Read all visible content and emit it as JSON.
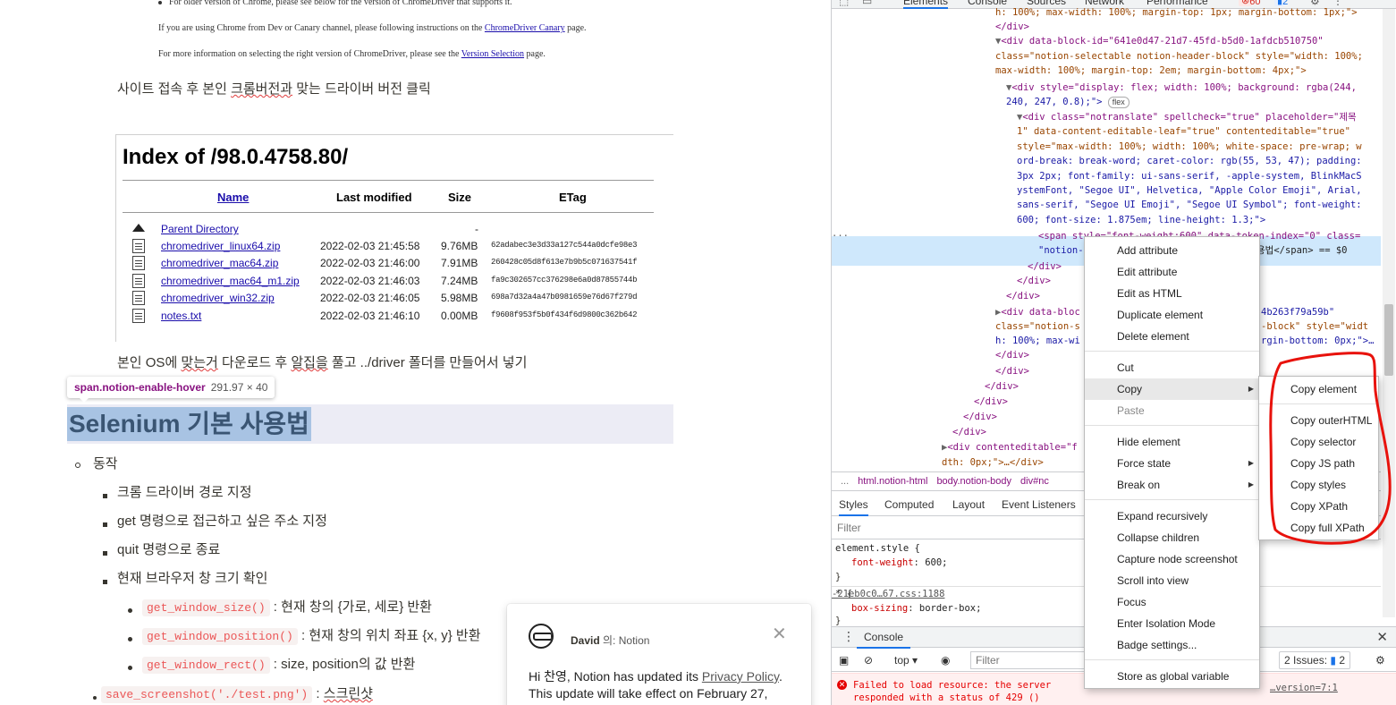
{
  "notion": {
    "top_note1": "For older version of Chrome, please see below for the version of ChromeDriver that supports it.",
    "top_note2_pre": "If you are using Chrome from Dev or Canary channel, please following instructions on the ",
    "top_note2_link": "ChromeDriver Canary",
    "top_note2_post": " page.",
    "top_note3_pre": "For more information on selecting the right version of ChromeDriver, please see the ",
    "top_note3_link": "Version Selection",
    "top_note3_post": " page.",
    "para1_a": "사이트 접속 후 본인 ",
    "para1_b": "크롬버전과",
    "para1_c": " 맞는 드라이버 버전 클릭",
    "index": {
      "title": "Index of /98.0.4758.80/",
      "headers": {
        "name": "Name",
        "modified": "Last modified",
        "size": "Size",
        "etag": "ETag"
      },
      "parent": "Parent Directory",
      "parent_size": "-",
      "rows": [
        {
          "name": "chromedriver_linux64.zip",
          "date": "2022-02-03 21:45:58",
          "size": "9.76MB",
          "etag": "62adabec3e3d33a127c544a0dcfe98e3"
        },
        {
          "name": "chromedriver_mac64.zip",
          "date": "2022-02-03 21:46:00",
          "size": "7.91MB",
          "etag": "260428c05d8f613e7b9b5c071637541f"
        },
        {
          "name": "chromedriver_mac64_m1.zip",
          "date": "2022-02-03 21:46:03",
          "size": "7.24MB",
          "etag": "fa9c302657cc376298e6a0d87855744b"
        },
        {
          "name": "chromedriver_win32.zip",
          "date": "2022-02-03 21:46:05",
          "size": "5.98MB",
          "etag": "698a7d32a4a47b0981659e76d67f279d"
        },
        {
          "name": "notes.txt",
          "date": "2022-02-03 21:46:10",
          "size": "0.00MB",
          "etag": "f9608f953f5b0f434f6d9800c362b642"
        }
      ]
    },
    "para2_a": "본인 OS에 ",
    "para2_b": "맞는거",
    "para2_c": " 다운로드 후 ",
    "para2_d": "알집을",
    "para2_e": " 풀고 ../driver 폴더를 만들어서 넣기",
    "hover_selector": "span.notion-enable-hover",
    "hover_dims": "291.97 × 40",
    "heading": "Selenium 기본 사용법",
    "list": {
      "l1": "동작",
      "l2a": "크롬 드라이버 경로 지정",
      "l2b": "get 명령으로 접근하고 싶은 주소 지정",
      "l2c": "quit 명령으로 종료",
      "l2d": "현재 브라우저 창 크기 확인",
      "c1": "get_window_size()",
      "t1": " : 현재 창의 {가로, 세로} 반환",
      "c2": "get_window_position()",
      "t2": " : 현재 창의 위치 좌표 {x, y} 반환",
      "c3": "get_window_rect()",
      "t3": " : size, position의 값 반환",
      "c4": "save_screenshot('./test.png')",
      "t4a": " : ",
      "t4b": "스크린샷"
    },
    "toast": {
      "author": "David",
      "via": " 의: Notion",
      "close": "✕",
      "msg_pre": "Hi 찬영, Notion has updated its ",
      "msg_link": "Privacy Policy",
      "msg_post": ". This update will take effect on February 27,"
    }
  },
  "devtools": {
    "tabs": [
      "Elements",
      "Console",
      "Sources",
      "Network",
      "Performance"
    ],
    "error_count": "60",
    "info_count": "2",
    "breadcrumbs": [
      "...",
      "html.notion-html",
      "body.notion-body",
      "div#nc"
    ],
    "styles_tabs": [
      "Styles",
      "Computed",
      "Layout",
      "Event Listeners"
    ],
    "filter_placeholder": "Filter",
    "styles": {
      "rule1_sel": "element.style {",
      "rule1_prop": "font-weight",
      "rule1_val": "600;",
      "close": "}",
      "rule2_sel": "* {",
      "rule2_prop": "box-sizing",
      "rule2_val": "border-box;",
      "rule2_src": "-21eb0c0…67.css:1188"
    },
    "console": {
      "tab": "Console",
      "context": "top",
      "filter_placeholder": "Filter",
      "issues_label": "2 Issues:",
      "issues_count": "2",
      "error_line1": "Failed to load resource: the server",
      "error_line2": "responded with a status of 429 ()",
      "error_src": "…version=7:1"
    },
    "elements_lines": [
      "h: 100%; max-width: 100%; margin-top: 1px; margin-bottom: 1px;\">",
      "</div>",
      "<div data-block-id=\"641e0d47-21d7-45fd-b5d0-1afdcb510750\"",
      "class=\"notion-selectable notion-header-block\" style=\"width: 100%;",
      "max-width: 100%; margin-top: 2em; margin-bottom: 4px;\">",
      "<div style=\"display: flex; width: 100%; background: rgba(244,",
      "240, 247, 0.8);\">",
      "<div class=\"notranslate\" spellcheck=\"true\" placeholder=\"제목",
      "1\" data-content-editable-leaf=\"true\" contenteditable=\"true\"",
      "style=\"max-width: 100%; width: 100%; white-space: pre-wrap; w",
      "ord-break: break-word; caret-color: rgb(55, 53, 47); padding:",
      "3px 2px; font-family: ui-sans-serif, -apple-system, BlinkMacS",
      "ystemFont, \"Segoe UI\", Helvetica, \"Apple Color Emoji\", Arial,",
      "sans-serif, \"Segoe UI Emoji\", \"Segoe UI Symbol\"; font-weight:",
      "600; font-size: 1.875em; line-height: 1.3;\">",
      "<span style=\"font-weight:600\" data-token-index=\"0\" class=",
      "\"notion-",
      "용법</span> == $0",
      "</div>",
      "</div>",
      "</div>",
      "<div data-bloc",
      "4b263f79a59b\"",
      "class=\"notion-s",
      "-block\" style=\"widt",
      "h: 100%; max-wi",
      "rgin-bottom: 0px;\">…",
      "</div>",
      "</div>",
      "</div>",
      "</div>",
      "</div>",
      "</div>",
      "<div contenteditable=\"f",
      "dth: 0px;\">…</div>"
    ],
    "flex_pill": "flex"
  },
  "context_menu": {
    "items": [
      "Add attribute",
      "Edit attribute",
      "Edit as HTML",
      "Duplicate element",
      "Delete element",
      "Cut",
      "Copy",
      "Paste",
      "Hide element",
      "Force state",
      "Break on",
      "Expand recursively",
      "Collapse children",
      "Capture node screenshot",
      "Scroll into view",
      "Focus",
      "Enter Isolation Mode",
      "Badge settings...",
      "Store as global variable"
    ],
    "submenu": [
      "Copy element",
      "Copy outerHTML",
      "Copy selector",
      "Copy JS path",
      "Copy styles",
      "Copy XPath",
      "Copy full XPath"
    ]
  },
  "colors": {
    "annotation": "#e8120c",
    "selection": "#cfe8fc",
    "heading_highlight": "#a8c3e3"
  }
}
